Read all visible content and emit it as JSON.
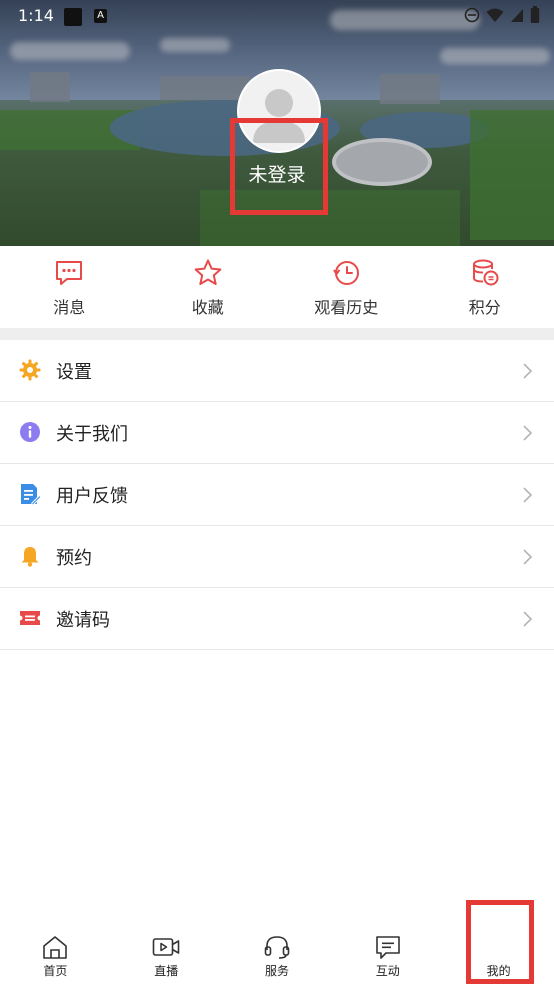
{
  "status_bar": {
    "time": "1:14",
    "badge": "A"
  },
  "profile": {
    "login_text": "未登录"
  },
  "quick_actions": [
    {
      "label": "消息",
      "icon": "message-icon"
    },
    {
      "label": "收藏",
      "icon": "star-icon"
    },
    {
      "label": "观看历史",
      "icon": "history-icon"
    },
    {
      "label": "积分",
      "icon": "points-icon"
    }
  ],
  "menu": [
    {
      "label": "设置",
      "icon": "settings-gear-icon",
      "color": "#f5a623"
    },
    {
      "label": "关于我们",
      "icon": "info-icon",
      "color": "#8c7cf0"
    },
    {
      "label": "用户反馈",
      "icon": "feedback-icon",
      "color": "#3a8ee6"
    },
    {
      "label": "预约",
      "icon": "bell-icon",
      "color": "#f5a623"
    },
    {
      "label": "邀请码",
      "icon": "invite-code-icon",
      "color": "#e84a4a"
    }
  ],
  "bottom_nav": [
    {
      "label": "首页",
      "icon": "home-icon"
    },
    {
      "label": "直播",
      "icon": "live-video-icon"
    },
    {
      "label": "服务",
      "icon": "headset-icon"
    },
    {
      "label": "互动",
      "icon": "chat-icon"
    },
    {
      "label": "我的",
      "icon": "profile-icon",
      "active": true
    }
  ],
  "colors": {
    "accent": "#e84a4a",
    "highlight_box": "#e53935"
  }
}
